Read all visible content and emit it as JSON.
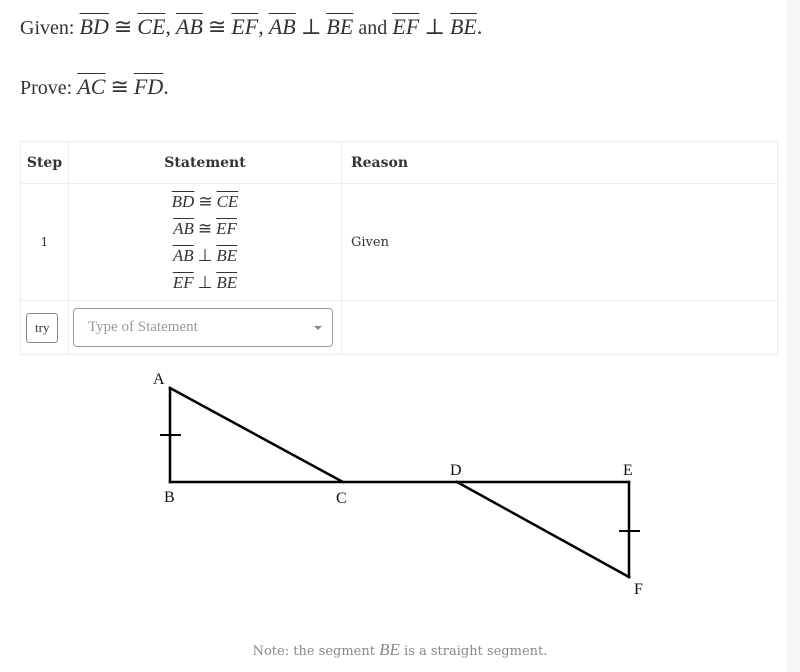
{
  "problem": {
    "given_label": "Given:",
    "given_parts": [
      {
        "left": "BD",
        "rel": "≅",
        "right": "CE"
      },
      {
        "left": "AB",
        "rel": "≅",
        "right": "EF"
      },
      {
        "left": "AB",
        "rel": "⊥",
        "right": "BE"
      },
      {
        "left": "EF",
        "rel": "⊥",
        "right": "BE"
      }
    ],
    "given_separator": ",",
    "given_conjunction": "and",
    "given_end": ".",
    "prove_label": "Prove:",
    "prove": {
      "left": "AC",
      "rel": "≅",
      "right": "FD"
    },
    "prove_end": "."
  },
  "table": {
    "headers": {
      "step": "Step",
      "statement": "Statement",
      "reason": "Reason"
    },
    "rows": [
      {
        "step": "1",
        "statements": [
          {
            "left": "BD",
            "rel": "≅",
            "right": "CE"
          },
          {
            "left": "AB",
            "rel": "≅",
            "right": "EF"
          },
          {
            "left": "AB",
            "rel": "⊥",
            "right": "BE"
          },
          {
            "left": "EF",
            "rel": "⊥",
            "right": "BE"
          }
        ],
        "reason": "Given"
      }
    ],
    "input_row": {
      "try_label": "try",
      "select_placeholder": "Type of Statement",
      "dropdown_icon": "caret-down-icon"
    }
  },
  "diagram": {
    "points": {
      "A": "A",
      "B": "B",
      "C": "C",
      "D": "D",
      "E": "E",
      "F": "F"
    },
    "segments": [
      "AB",
      "BC",
      "AC",
      "BE",
      "DF",
      "EF"
    ],
    "tick_marks_on": [
      "AB",
      "EF"
    ]
  },
  "note": {
    "prefix": "Note: the segment",
    "segment": "BE",
    "suffix": "is a straight segment."
  }
}
